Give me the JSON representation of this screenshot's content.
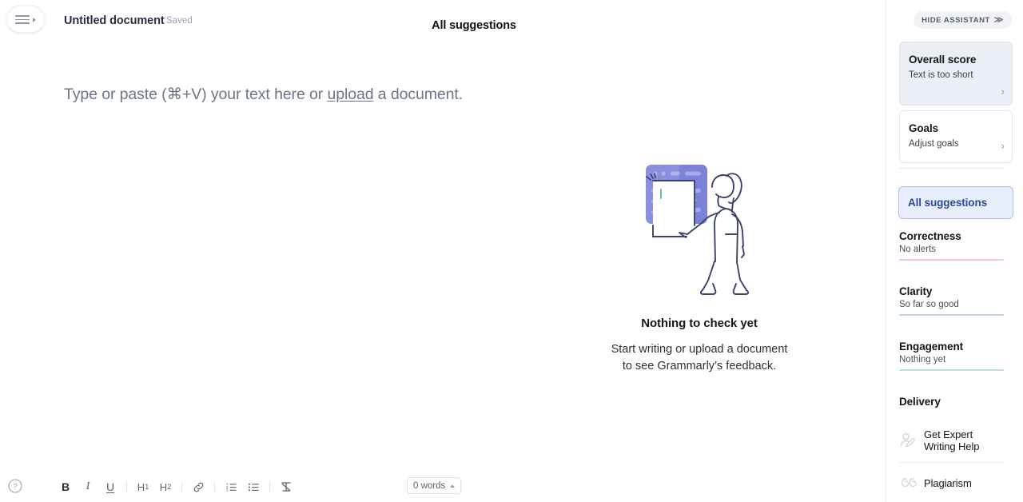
{
  "topbar": {
    "menu_icon": "hamburger-menu-icon",
    "document_title": "Untitled document",
    "save_status": "Saved",
    "center_heading": "All suggestions"
  },
  "editor": {
    "placeholder_before": "Type or paste (⌘+V) your text here or ",
    "placeholder_link": "upload",
    "placeholder_after": " a document."
  },
  "empty_state": {
    "illustration_name": "person-pointing-at-document-illustration",
    "title": "Nothing to check yet",
    "subtitle_line1": "Start writing or upload a document",
    "subtitle_line2": "to see Grammarly’s feedback."
  },
  "bottom_bar": {
    "help_icon": "question-mark-circle-icon",
    "tools": [
      {
        "name": "bold-button",
        "label": "B"
      },
      {
        "name": "italic-button",
        "label": "I"
      },
      {
        "name": "underline-button",
        "label": "U"
      },
      {
        "name": "heading1-button",
        "label": "H",
        "sub": "1"
      },
      {
        "name": "heading2-button",
        "label": "H",
        "sub": "2"
      },
      {
        "name": "link-button",
        "label": "link-icon"
      },
      {
        "name": "numbered-list-button",
        "label": "numbered-list-icon"
      },
      {
        "name": "bulleted-list-button",
        "label": "bulleted-list-icon"
      },
      {
        "name": "clear-formatting-button",
        "label": "clear-formatting-icon"
      }
    ],
    "word_count": "0 words"
  },
  "sidebar": {
    "hide_assistant": {
      "label": "HIDE ASSISTANT",
      "chevron": "≫"
    },
    "cards": [
      {
        "name": "overall-score-card",
        "title": "Overall score",
        "subtitle": "Text is too short",
        "arrow": "›"
      },
      {
        "name": "goals-card",
        "title": "Goals",
        "subtitle": "Adjust goals",
        "arrow": "›"
      }
    ],
    "all_suggestions_button": "All suggestions",
    "categories": [
      {
        "name": "correctness",
        "title": "Correctness",
        "status": "No alerts",
        "color": "#f5c9cd"
      },
      {
        "name": "clarity",
        "title": "Clarity",
        "status": "So far so good",
        "color": "#b9d4ef"
      },
      {
        "name": "engagement",
        "title": "Engagement",
        "status": "Nothing yet",
        "color": "#bfe3d2"
      }
    ],
    "delivery_label": "Delivery",
    "services": [
      {
        "name": "get-expert-writing-help",
        "icon": "person-pen-icon",
        "line1": "Get Expert",
        "line2": "Writing Help"
      },
      {
        "name": "plagiarism",
        "icon": "quotation-marks-icon",
        "line1": "Plagiarism",
        "line2": ""
      }
    ]
  },
  "colors": {
    "accent_blue": "#2c4a9a",
    "panel_blue": "#e8eefb",
    "score_card_bg": "#eceef6",
    "illustration_purple": "#8b8fe0"
  }
}
